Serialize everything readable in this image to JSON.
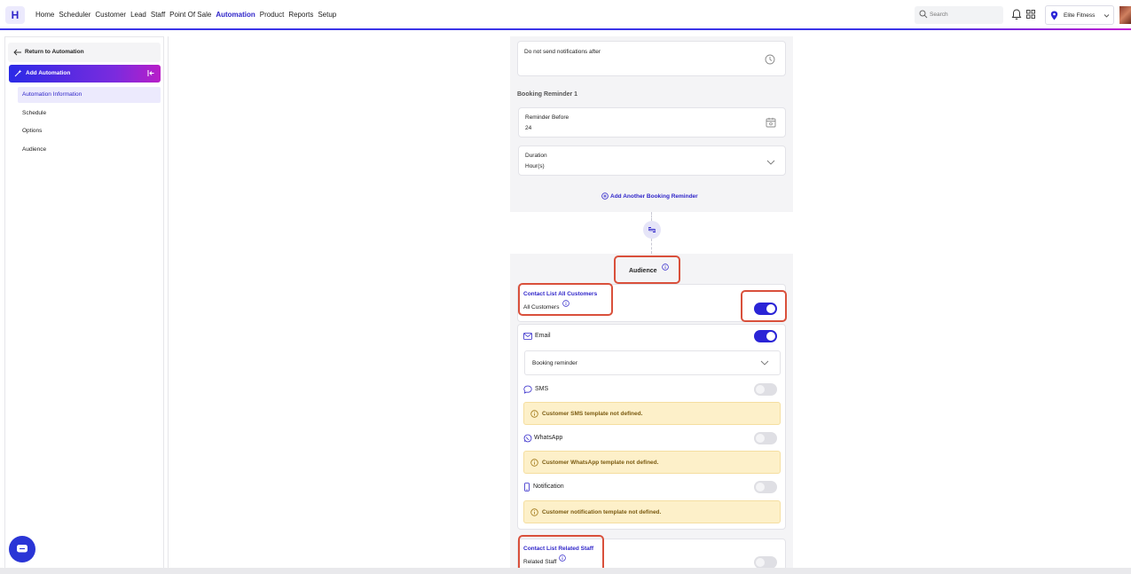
{
  "nav": {
    "logo": "H",
    "items": [
      "Home",
      "Scheduler",
      "Customer",
      "Lead",
      "Staff",
      "Point Of Sale",
      "Automation",
      "Product",
      "Reports",
      "Setup"
    ],
    "active": "Automation",
    "search_placeholder": "Search",
    "location": "Elite Fitness"
  },
  "sidebar": {
    "return_label": "Return to Automation",
    "section_label": "Add Automation",
    "items": [
      "Automation Information",
      "Schedule",
      "Options",
      "Audience"
    ]
  },
  "reminder": {
    "no_notify_label": "Do not send notifications after",
    "booking_reminder_title": "Booking Reminder 1",
    "reminder_before_label": "Reminder Before",
    "reminder_before_value": "24",
    "duration_label": "Duration",
    "duration_value": "Hour(s)",
    "add_another": "Add Another Booking Reminder"
  },
  "audience": {
    "title": "Audience",
    "customers": {
      "title": "Contact List All Customers",
      "subtitle": "All Customers",
      "enabled": true,
      "channels": {
        "email": {
          "label": "Email",
          "enabled": true,
          "template": "Booking reminder"
        },
        "sms": {
          "label": "SMS",
          "enabled": false,
          "warning": "Customer SMS template not defined."
        },
        "whatsapp": {
          "label": "WhatsApp",
          "enabled": false,
          "warning": "Customer WhatsApp template not defined."
        },
        "notification": {
          "label": "Notification",
          "enabled": false,
          "warning": "Customer notification template not defined."
        }
      }
    },
    "staff": {
      "title": "Contact List Related Staff",
      "subtitle": "Related Staff",
      "enabled": false
    }
  },
  "colors": {
    "accent": "#2a24d6",
    "highlight": "#d9503b",
    "warning_bg": "#fdf0c9"
  }
}
